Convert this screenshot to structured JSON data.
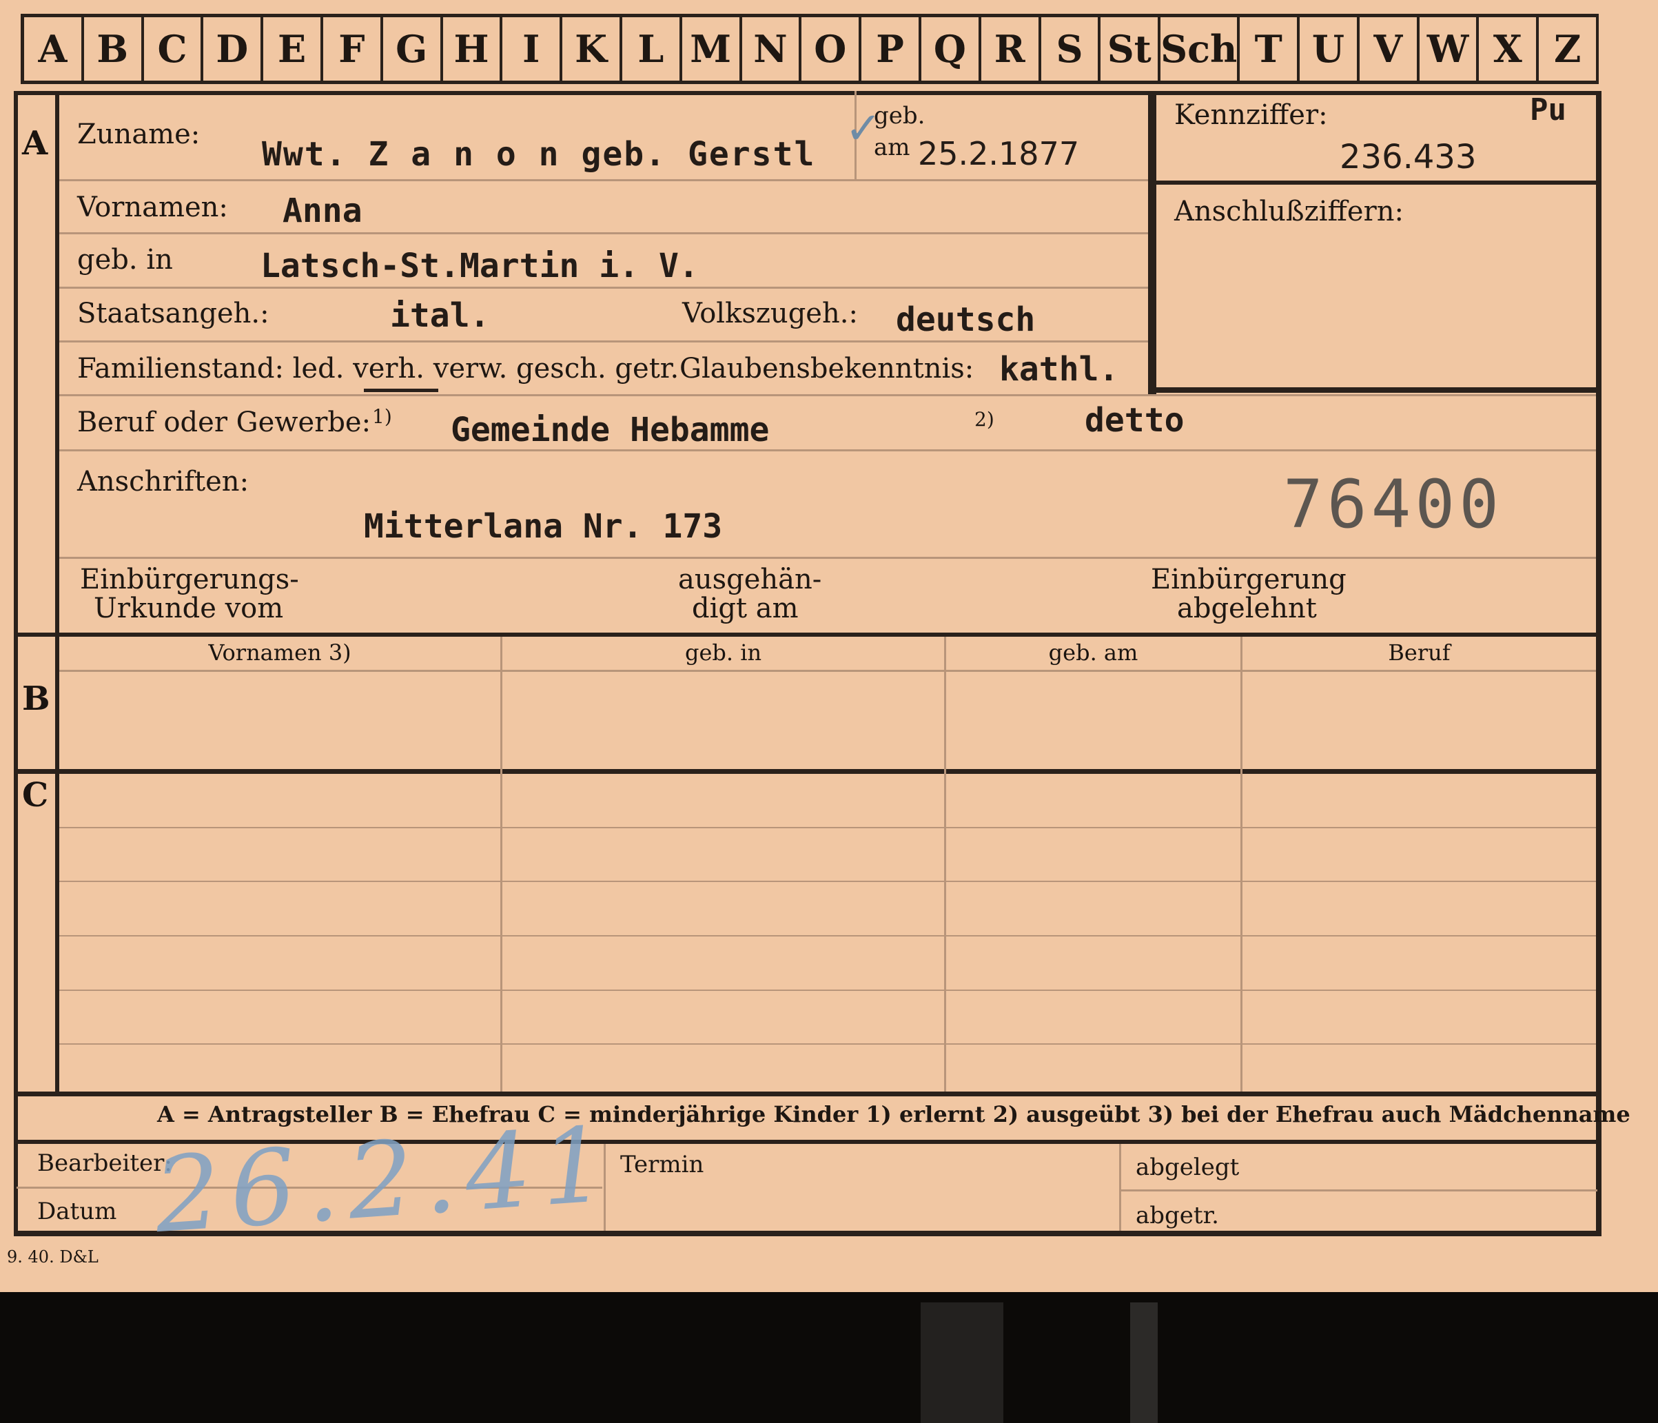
{
  "alphabet": [
    "A",
    "B",
    "C",
    "D",
    "E",
    "F",
    "G",
    "H",
    "I",
    "K",
    "L",
    "M",
    "N",
    "O",
    "P",
    "Q",
    "R",
    "S",
    "St",
    "Sch",
    "T",
    "U",
    "V",
    "W",
    "X",
    "Z"
  ],
  "sections": {
    "a": "A",
    "b": "B",
    "c": "C"
  },
  "fields": {
    "zuname_label": "Zuname:",
    "zuname_value": "Wwt. Z a n o n  geb. Gerstl",
    "geb_label": "geb.",
    "am_label": "am",
    "geb_am_value": "25.2.1877",
    "kennziffer_label": "Kennziffer:",
    "kennziffer_code": "Pu",
    "kennziffer_value": "236.433",
    "anschluss_label": "Anschlußziffern:",
    "vornamen_label": "Vornamen:",
    "vornamen_value": "Anna",
    "gebin_label": "geb. in",
    "gebin_value": "Latsch-St.Martin  i. V.",
    "staat_label": "Staatsangeh.:",
    "staat_value": "ital.",
    "volk_label": "Volkszugeh.:",
    "volk_value": "deutsch",
    "familien_label": "Familienstand: led. verh. verw. gesch. getr.",
    "glaube_label": "Glaubensbekenntnis:",
    "glaube_value": "kathl.",
    "beruf_label": "Beruf oder Gewerbe:",
    "beruf_mark1": "1)",
    "beruf_value": "Gemeinde Hebamme",
    "beruf_mark2": "2)",
    "beruf_value2": "detto",
    "anschriften_label": "Anschriften:",
    "anschriften_value": "Mitterlana  Nr. 173",
    "stamp_number": "76400",
    "urkunde_label_1": "Einbürgerungs-",
    "urkunde_label_2": "Urkunde vom",
    "ausgehaendigt_1": "ausgehän-",
    "ausgehaendigt_2": "digt am",
    "abgelehnt_1": "Einbürgerung",
    "abgelehnt_2": "abgelehnt"
  },
  "table_headers": [
    "Vornamen 3)",
    "geb. in",
    "geb. am",
    "Beruf"
  ],
  "legend": "A = Antragsteller   B = Ehefrau   C = minderjährige Kinder   1) erlernt   2) ausgeübt   3) bei der Ehefrau auch Mädchenname",
  "footer": {
    "bearbeiter_label": "Bearbeiter:",
    "datum_label": "Datum",
    "handwritten_date": "26.2.41",
    "termin_label": "Termin",
    "abgelegt_label": "abgelegt",
    "abgetr_label": "abgetr.",
    "print_code": "9. 40. D&L"
  }
}
